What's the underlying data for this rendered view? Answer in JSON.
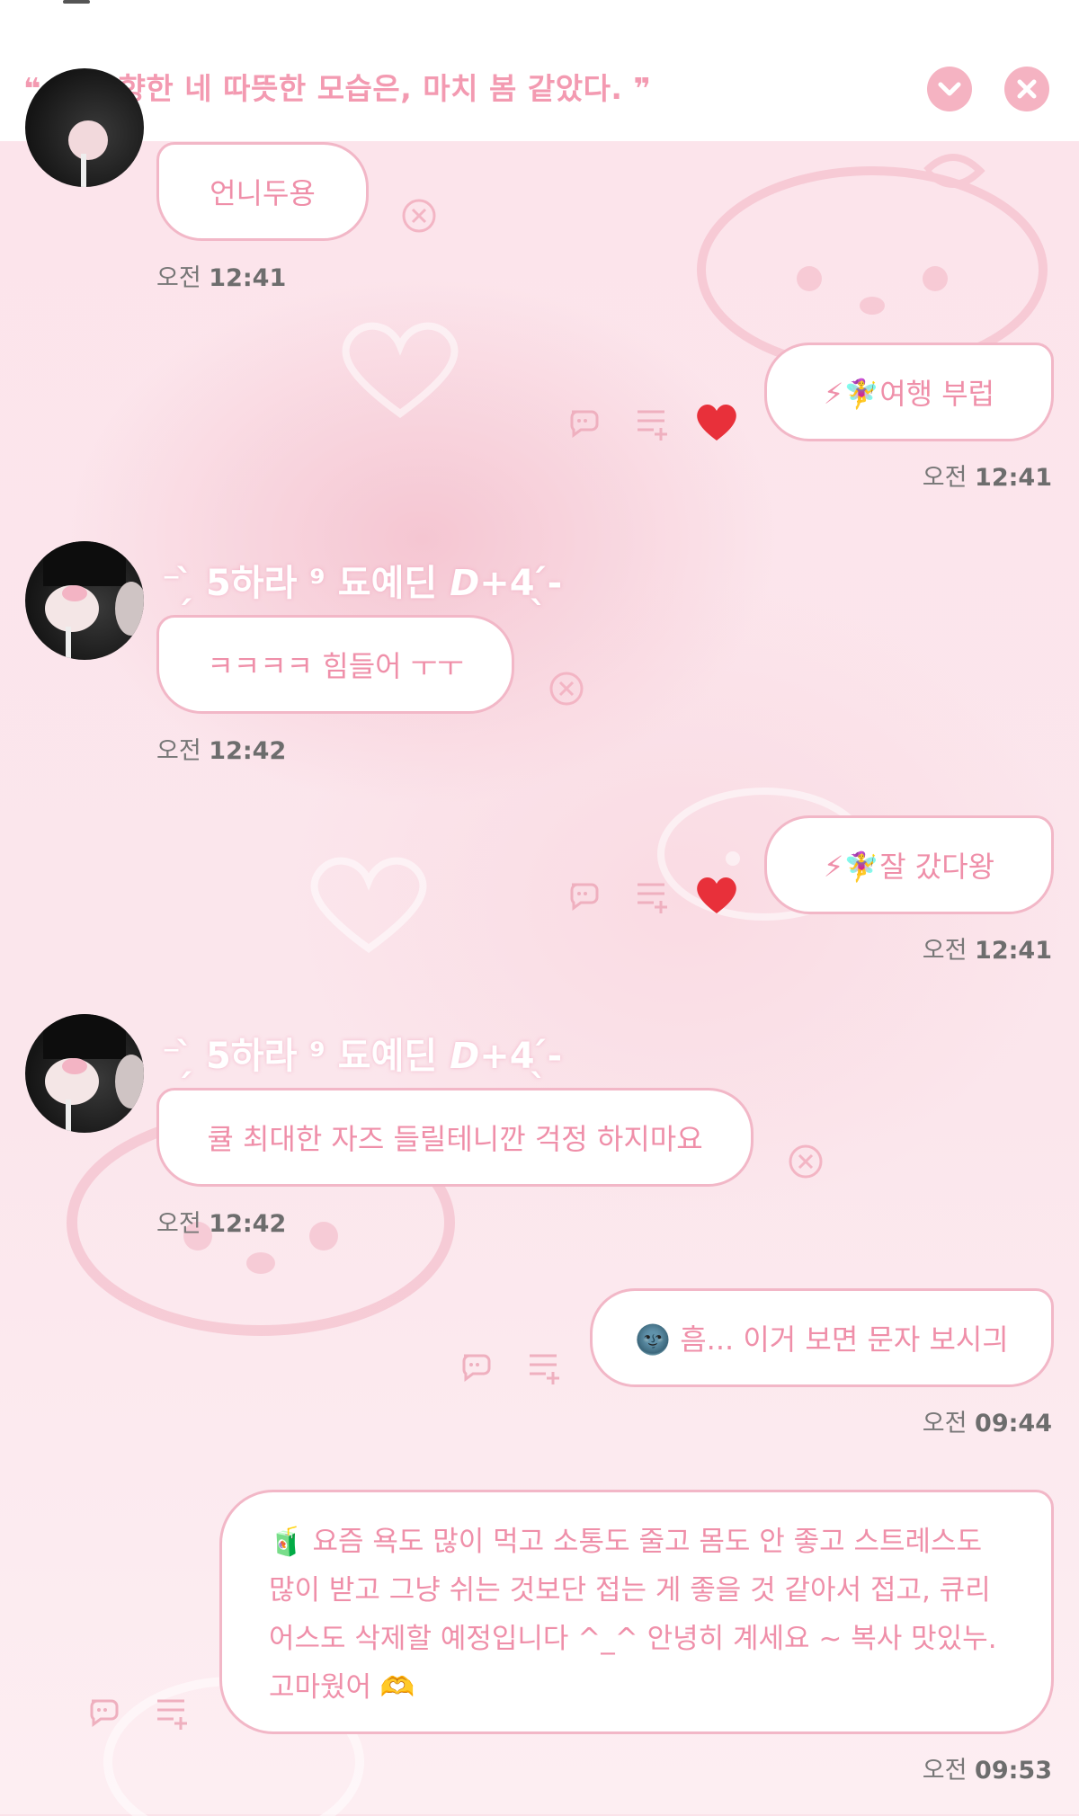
{
  "notice": {
    "text": "❝ 나를 향한 네 따뜻한 모습은, 마치 봄 같았다. ❞"
  },
  "sender_name": "⁻ ̗̀ 5하라 ⁹ 됴예딘 𝘿+𝟰 ̖́-",
  "messages": [
    {
      "side": "left",
      "text": "언니두용",
      "time_prefix": "오전",
      "time": "12:41"
    },
    {
      "side": "right",
      "text": "⚡🧚‍♀️여행 부럽",
      "time_prefix": "오전",
      "time": "12:41"
    },
    {
      "side": "left",
      "text": "ㅋㅋㅋㅋ 힘들어 ㅜㅜ",
      "time_prefix": "오전",
      "time": "12:42"
    },
    {
      "side": "right",
      "text": "⚡🧚‍♀️잘 갔다왕",
      "time_prefix": "오전",
      "time": "12:41"
    },
    {
      "side": "left",
      "text": "큘 최대한 자즈 들릴테니깐 걱정 하지마요",
      "time_prefix": "오전",
      "time": "12:42"
    },
    {
      "side": "right",
      "text": "🌚 흠... 이거 보면 문자 보시긔",
      "time_prefix": "오전",
      "time": "09:44"
    },
    {
      "side": "right",
      "lines": [
        "🧃 요즘 욕도 많이 먹고 소통도 줄고 몸도 안 좋고 스트레스도",
        "많이 받고 그냥 쉬는 것보단 접는 게 좋을 것 같아서 접고, 큐리",
        "어스도 삭제할 예정입니다 ^_^ 안녕히 계세요 ~ 복사 맛있누.",
        "고마웠어 🫶"
      ],
      "time_prefix": "오전",
      "time": "09:53"
    }
  ],
  "colors": {
    "accent_pink": "#f39ab1",
    "bubble_border": "#f2b7c7",
    "heart_red": "#e8303a"
  }
}
